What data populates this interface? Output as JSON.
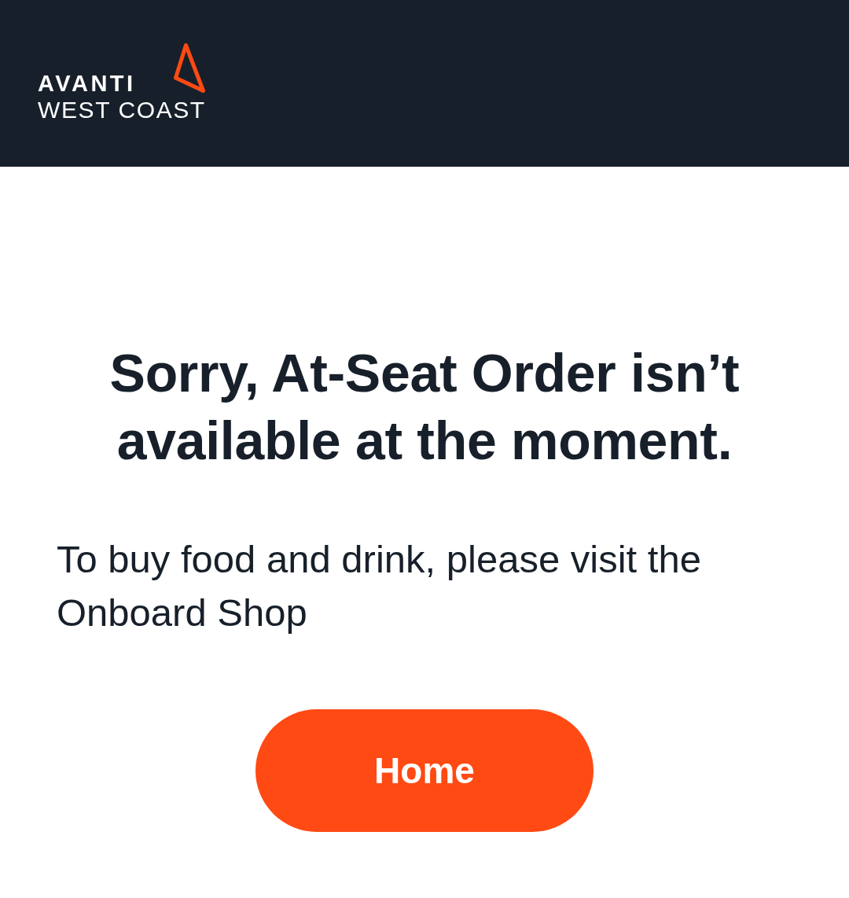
{
  "header": {
    "logo": {
      "line_1": "AVANTI",
      "line_2": "WEST COAST"
    }
  },
  "message": {
    "title": "Sorry, At-Seat Order isn’t available at the moment.",
    "body": "To buy food and drink, please visit the Onboard Shop"
  },
  "button": {
    "label": "Home"
  }
}
